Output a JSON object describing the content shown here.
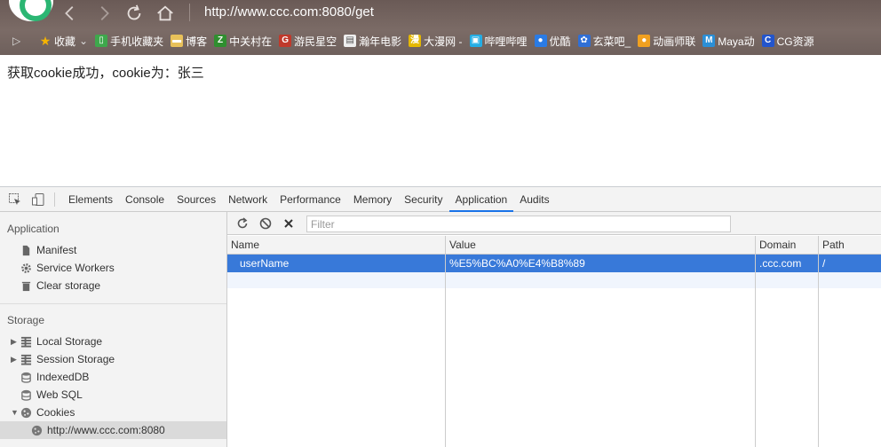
{
  "browser": {
    "url": "http://www.ccc.com:8080/get",
    "bookmarks": [
      {
        "label": "收藏",
        "icon": "star-icon",
        "color": "#f5b400",
        "arrow": "⌄"
      },
      {
        "label": "手机收藏夹",
        "icon": "phone-icon",
        "color": "#3ea84c"
      },
      {
        "label": "博客",
        "icon": "folder-icon",
        "color": "#e8c15a"
      },
      {
        "label": "中关村在",
        "icon": "zol-icon",
        "color": "#2f8f2f"
      },
      {
        "label": "游民星空",
        "icon": "gamersky-icon",
        "color": "#c0392b"
      },
      {
        "label": "瀚年电影",
        "icon": "page-icon",
        "color": "#eeeeee"
      },
      {
        "label": "大漫网 -",
        "icon": "dmw-icon",
        "color": "#e5b800"
      },
      {
        "label": "哔哩哔哩",
        "icon": "bilibili-icon",
        "color": "#23ade5"
      },
      {
        "label": "优酷",
        "icon": "youku-icon",
        "color": "#2a7be4"
      },
      {
        "label": "玄菜吧_",
        "icon": "baidu-paw-icon",
        "color": "#2f6fd6"
      },
      {
        "label": "动画师联",
        "icon": "anim-icon",
        "color": "#f0a020"
      },
      {
        "label": "Maya动",
        "icon": "maya-icon",
        "color": "#2b8fd6"
      },
      {
        "label": "CG资源",
        "icon": "cg-icon",
        "color": "#2255cc"
      }
    ]
  },
  "page": {
    "message": "获取cookie成功，cookie为：张三"
  },
  "devtools": {
    "tabs": [
      "Elements",
      "Console",
      "Sources",
      "Network",
      "Performance",
      "Memory",
      "Security",
      "Application",
      "Audits"
    ],
    "active_tab": "Application",
    "sidebar": {
      "application_title": "Application",
      "application_items": [
        "Manifest",
        "Service Workers",
        "Clear storage"
      ],
      "storage_title": "Storage",
      "storage_items": [
        "Local Storage",
        "Session Storage",
        "IndexedDB",
        "Web SQL",
        "Cookies"
      ],
      "cookie_origin": "http://www.ccc.com:8080"
    },
    "filter_placeholder": "Filter",
    "table": {
      "headers": [
        "Name",
        "Value",
        "Domain",
        "Path"
      ],
      "rows": [
        {
          "name": "userName",
          "value": "%E5%BC%A0%E4%B8%89",
          "domain": ".ccc.com",
          "path": "/"
        }
      ]
    },
    "accent_color": "#1a73e8",
    "selected_row_color": "#3879d9"
  }
}
